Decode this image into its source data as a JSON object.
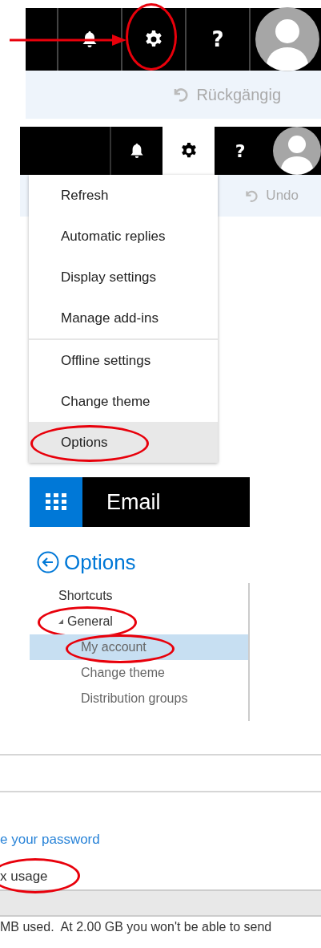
{
  "header_bar_1": {
    "pointer_arrow": true,
    "buttons": [
      {
        "kind": "bell",
        "highlighted": false
      },
      {
        "kind": "settings",
        "highlighted": true
      },
      {
        "kind": "help",
        "label": "?",
        "highlighted": false
      },
      {
        "kind": "avatar",
        "highlighted": false
      }
    ]
  },
  "undo_bar_1": {
    "label": "Rückgängig"
  },
  "header_bar_2": {
    "buttons": [
      {
        "kind": "bell",
        "open": false
      },
      {
        "kind": "settings",
        "open": true
      },
      {
        "kind": "help",
        "label": "?",
        "open": false
      },
      {
        "kind": "avatar",
        "open": false
      }
    ]
  },
  "undo_bar_2": {
    "label": "Undo"
  },
  "settings_menu": {
    "groups": [
      {
        "items": [
          {
            "label": "Refresh",
            "hovered": false,
            "highlighted": false
          },
          {
            "label": "Automatic replies",
            "hovered": false,
            "highlighted": false
          },
          {
            "label": "Display settings",
            "hovered": false,
            "highlighted": false
          },
          {
            "label": "Manage add-ins",
            "hovered": false,
            "highlighted": false
          }
        ]
      },
      {
        "items": [
          {
            "label": "Offline settings",
            "hovered": false,
            "highlighted": false
          },
          {
            "label": "Change theme",
            "hovered": false,
            "highlighted": false
          },
          {
            "label": "Options",
            "hovered": true,
            "highlighted": true
          }
        ]
      }
    ]
  },
  "app_bar": {
    "title": "Email"
  },
  "options_nav": {
    "title": "Options",
    "items": [
      {
        "label": "Shortcuts",
        "selected": false,
        "highlighted": false
      },
      {
        "label": "General",
        "selected": false,
        "highlighted": true,
        "expanded": true,
        "children": [
          {
            "label": "My account",
            "selected": true,
            "highlighted": true
          },
          {
            "label": "Change theme",
            "selected": false,
            "highlighted": false
          },
          {
            "label": "Distribution groups",
            "selected": false,
            "highlighted": false
          }
        ]
      }
    ]
  },
  "account_page": {
    "password_link": "e your password",
    "usage_heading": "x usage",
    "usage_heading_highlighted": true,
    "usage_text": "MB used.  At 2.00 GB you won't be able to send"
  }
}
